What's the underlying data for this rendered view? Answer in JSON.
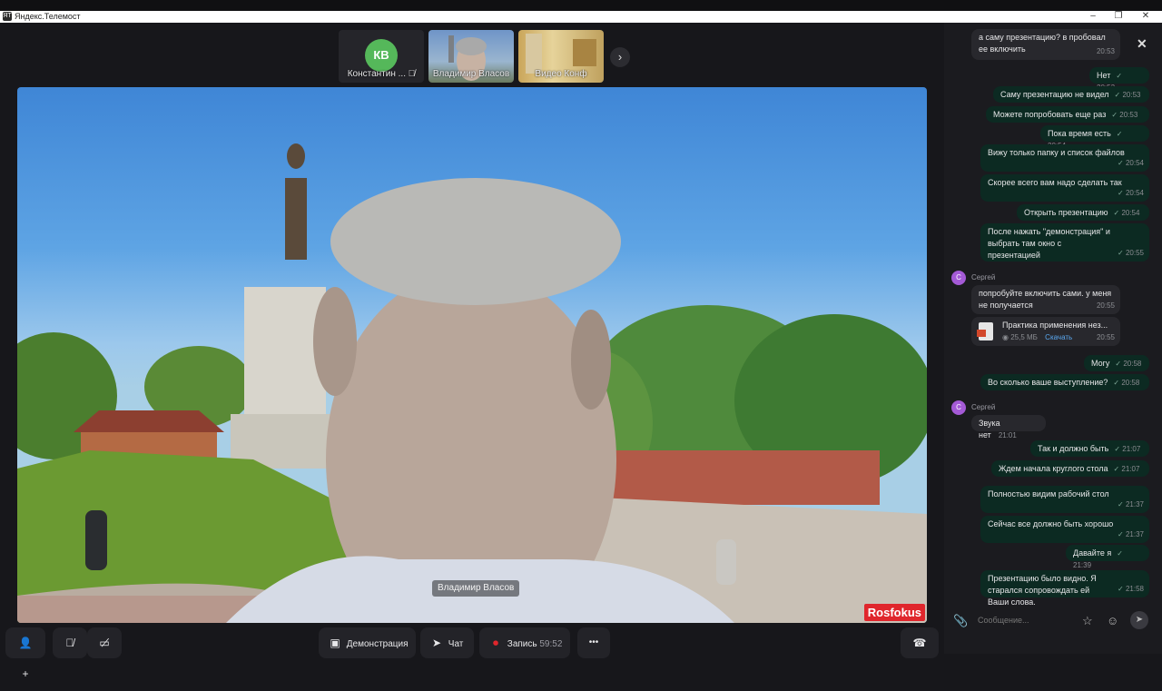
{
  "window": {
    "title": "Яндекс.Телемост",
    "logo": "ЯТ"
  },
  "participants": [
    {
      "initials": "КВ",
      "name": "Константин ..."
    },
    {
      "name": "Владимир Власов"
    },
    {
      "name": "Видео Конф"
    }
  ],
  "video": {
    "speaker": "Владимир Власов",
    "watermark": "Rosfokus"
  },
  "controls": {
    "screenshare_label": "Демонстрация",
    "chat_label": "Чат",
    "record_label": "Запись",
    "record_time": "59:52",
    "more_label": "•••"
  },
  "chat": {
    "messages": [
      {
        "dir": "in",
        "text": "а саму презентацию? в пробовал ее включить",
        "time": "20:53"
      },
      {
        "dir": "out",
        "text": "Нет",
        "time": "20:53"
      },
      {
        "dir": "out",
        "text": "Саму презентацию не видел",
        "time": "20:53"
      },
      {
        "dir": "out",
        "text": "Можете попробовать еще раз",
        "time": "20:53"
      },
      {
        "dir": "out",
        "text": "Пока время есть",
        "time": "20:54"
      },
      {
        "dir": "out",
        "text": "Вижу только папку и список файлов",
        "time": "20:54"
      },
      {
        "dir": "out",
        "text": "Скорее всего вам надо сделать так",
        "time": "20:54"
      },
      {
        "dir": "out",
        "text": "Открыть презентацию",
        "time": "20:54"
      },
      {
        "dir": "out",
        "text": "После нажать \"демонстрация\" и выбрать там окно с презентацией",
        "time": "20:55"
      },
      {
        "dir": "in",
        "sender": "Сергей",
        "text": "попробуйте включить сами. у меня не получается",
        "time": "20:55"
      },
      {
        "dir": "in",
        "file": true,
        "filename": "Практика применения нез...",
        "size": "25,5 МБ",
        "download": "Скачать",
        "time": "20:55"
      },
      {
        "dir": "out",
        "text": "Могу",
        "time": "20:58"
      },
      {
        "dir": "out",
        "text": "Во сколько ваше выступление?",
        "time": "20:58"
      },
      {
        "dir": "in",
        "sender": "Сергей",
        "text": "Звука нет",
        "time": "21:01"
      },
      {
        "dir": "out",
        "text": "Так и должно быть",
        "time": "21:07"
      },
      {
        "dir": "out",
        "text": "Ждем начала круглого стола",
        "time": "21:07"
      },
      {
        "dir": "out",
        "text": "Полностью видим рабочий стол",
        "time": "21:37"
      },
      {
        "dir": "out",
        "text": "Сейчас все должно быть хорошо",
        "time": "21:37"
      },
      {
        "dir": "out",
        "text": "Давайте я",
        "time": "21:39"
      },
      {
        "dir": "out",
        "text": "Презентацию было видно. Я старался сопровождать ей Ваши слова.",
        "time": "21:58"
      }
    ],
    "sender_initial": "С",
    "placeholder": "Сообщение..."
  },
  "colors": {
    "outgoing_bubble": "#0c2a22",
    "incoming_bubble": "#28282d",
    "record_dot": "#e0262c",
    "avatar_kv": "#55b85a",
    "avatar_sergey": "#a45ad6"
  }
}
